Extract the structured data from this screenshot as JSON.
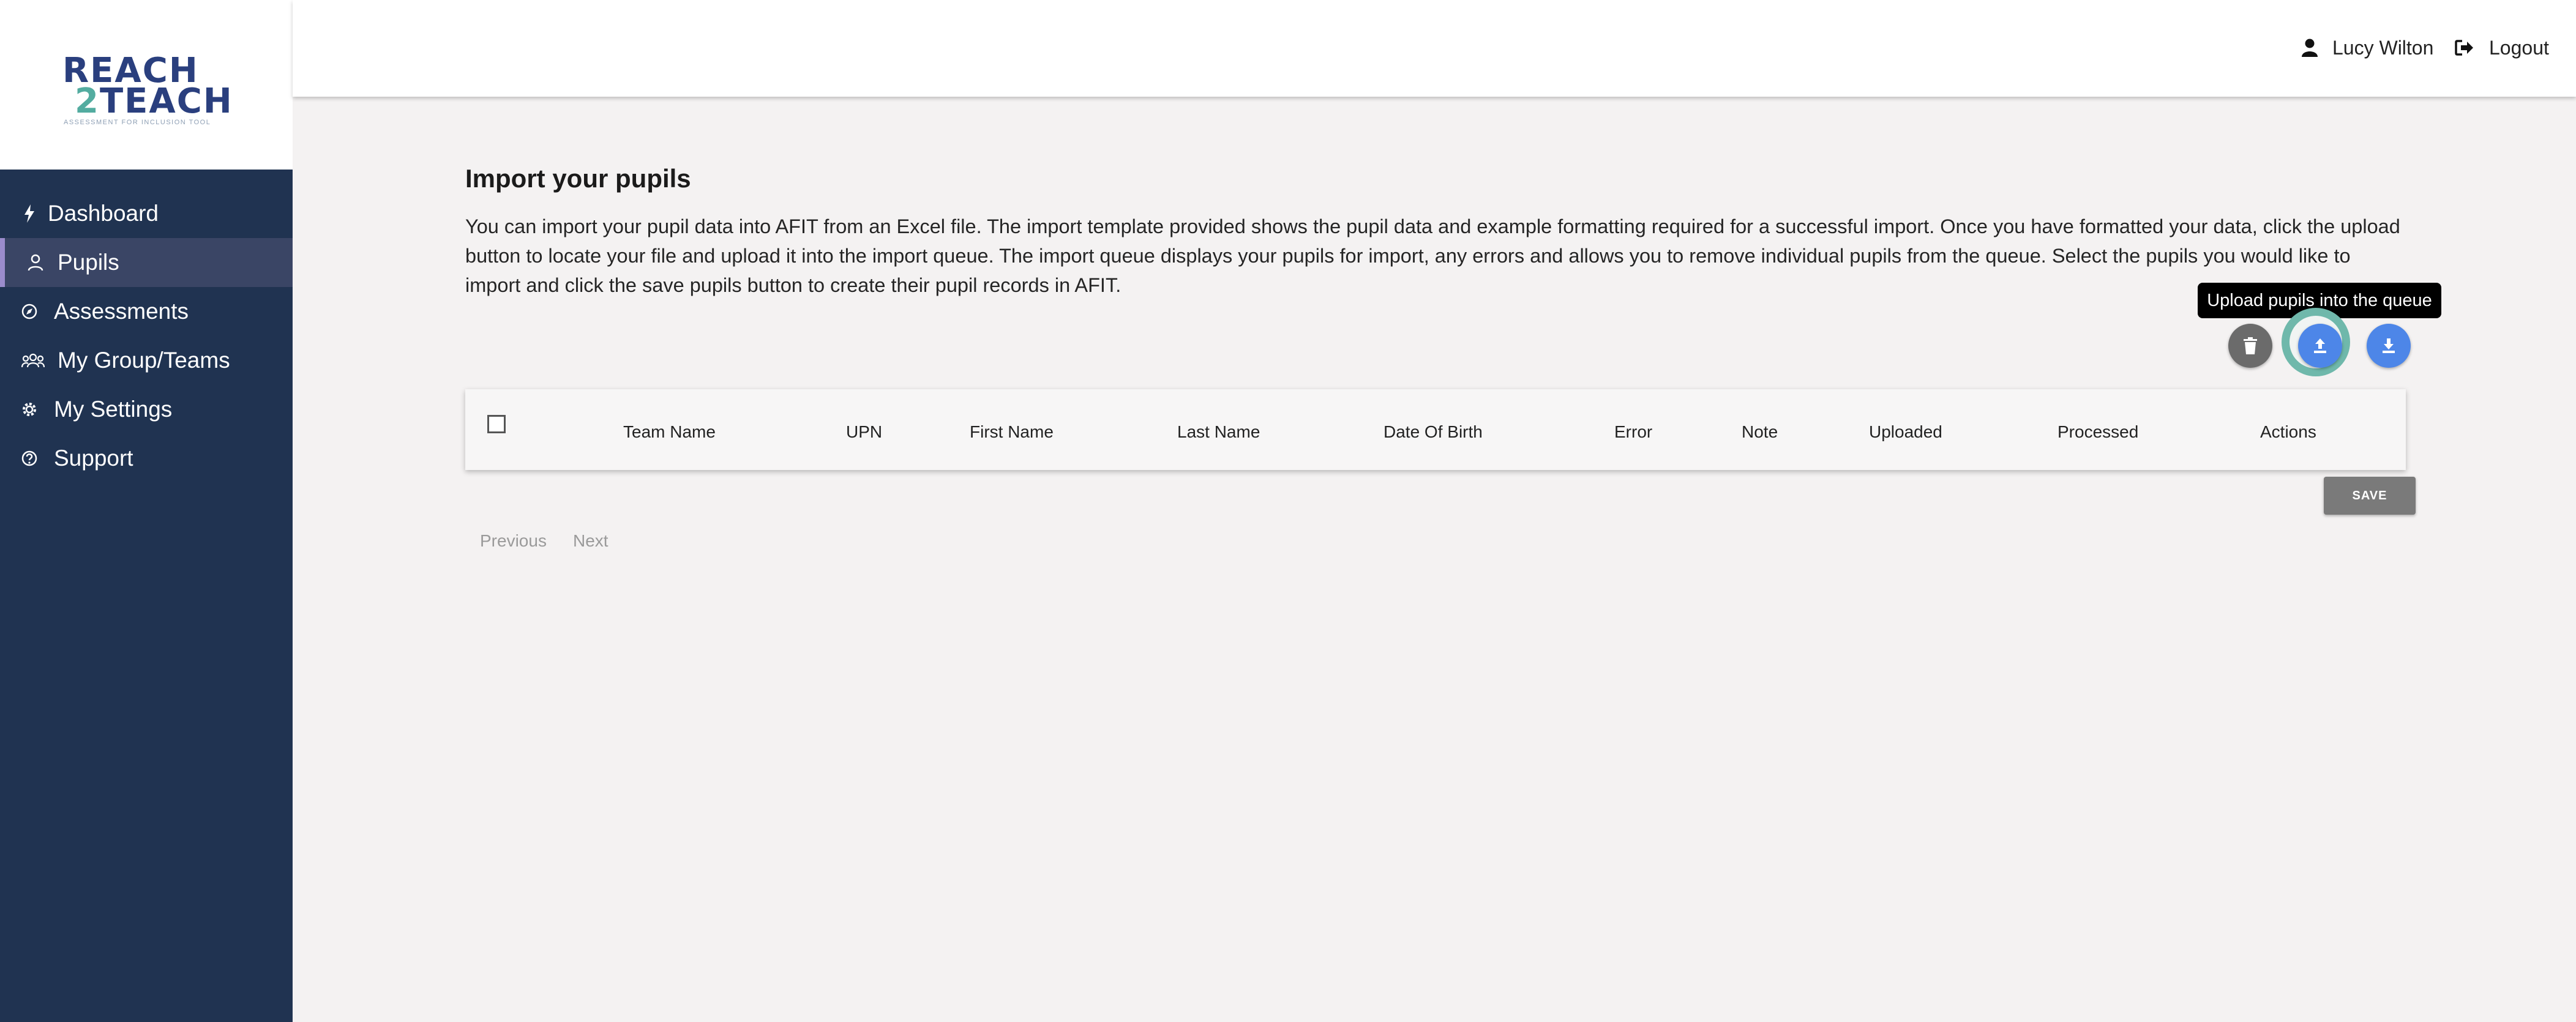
{
  "logo": {
    "line1": "REACH",
    "line2_num": "2",
    "line2_word": "TEACH",
    "tagline": "ASSESSMENT FOR INCLUSION TOOL"
  },
  "sidebar": {
    "items": [
      {
        "label": "Dashboard",
        "icon": "bolt-icon"
      },
      {
        "label": "Pupils",
        "icon": "person-icon",
        "active": true
      },
      {
        "label": "Assessments",
        "icon": "compass-icon"
      },
      {
        "label": "My Group/Teams",
        "icon": "group-icon"
      },
      {
        "label": "My Settings",
        "icon": "gear-icon"
      },
      {
        "label": "Support",
        "icon": "help-icon"
      }
    ]
  },
  "header": {
    "user_name": "Lucy Wilton",
    "logout_label": "Logout"
  },
  "main": {
    "title": "Import your pupils",
    "description": "You can import your pupil data into AFIT from an Excel file. The import template provided shows the pupil data and example formatting required for a successful import. Once you have formatted your data, click the upload button to locate your file and upload it into the import queue. The import queue displays your pupils for import, any errors and allows you to remove individual pupils from the queue. Select the pupils you would like to import and click the save pupils button to create their pupil records in AFIT.",
    "tooltip": "Upload pupils into the queue",
    "table": {
      "columns": [
        "Team Name",
        "UPN",
        "First Name",
        "Last Name",
        "Date Of Birth",
        "Error",
        "Note",
        "Uploaded",
        "Processed",
        "Actions"
      ]
    },
    "save_label": "SAVE",
    "pager": {
      "previous": "Previous",
      "next": "Next"
    }
  },
  "colors": {
    "sidebar_bg": "#203351",
    "active_item_bg": "#3a4565",
    "active_accent": "#9b8ccc",
    "action_blue": "#4d86e8",
    "delete_grey": "#6b6b6b",
    "focus_ring": "#6fb8ab"
  }
}
